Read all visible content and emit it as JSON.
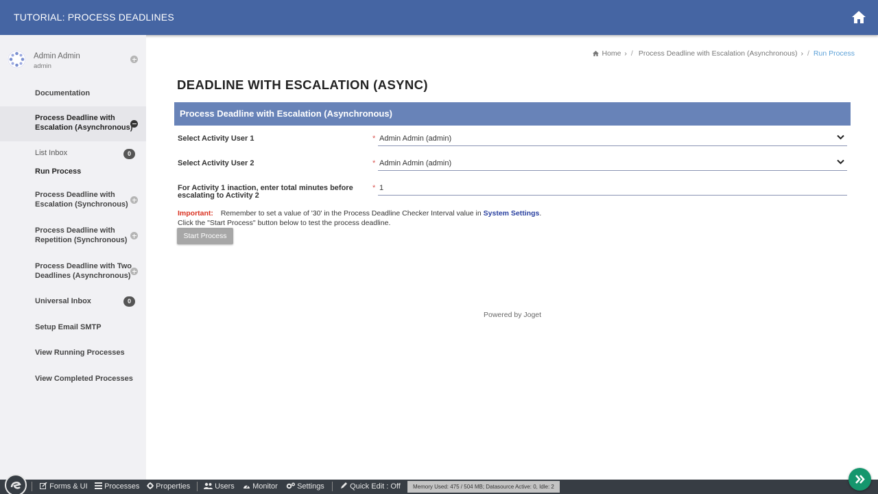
{
  "header": {
    "app_title": "TUTORIAL: PROCESS DEADLINES",
    "home_icon": "home-icon"
  },
  "sidebar": {
    "profile": {
      "name": "Admin Admin",
      "username": "admin"
    },
    "items": [
      {
        "label": "Documentation"
      },
      {
        "label_line1": "Process Deadline with",
        "label_line2": "Escalation (Asynchronous)",
        "active": true
      },
      {
        "label": "List Inbox",
        "badge": "0"
      },
      {
        "label": "Run Process"
      },
      {
        "label_line1": "Process Deadline with",
        "label_line2": "Escalation (Synchronous)"
      },
      {
        "label_line1": "Process Deadline with",
        "label_line2": "Repetition (Synchronous)"
      },
      {
        "label_line1": "Process Deadline with Two",
        "label_line2": "Deadlines (Asynchronous)"
      },
      {
        "label": "Universal Inbox",
        "badge": "0"
      },
      {
        "label": "Setup Email SMTP"
      },
      {
        "label": "View Running Processes"
      },
      {
        "label": "View Completed Processes"
      }
    ]
  },
  "breadcrumb": {
    "home": "Home",
    "parent": "Process Deadline with Escalation (Asynchronous)",
    "current": "Run Process"
  },
  "page": {
    "title": "DEADLINE WITH ESCALATION (ASYNC)",
    "form_header": "Process Deadline with Escalation (Asynchronous)",
    "fields": [
      {
        "label": "Select Activity User 1",
        "value": "Admin Admin (admin)"
      },
      {
        "label": "Select Activity User 2",
        "value": "Admin Admin (admin)"
      },
      {
        "label_line1": "For Activity 1 inaction, enter total minutes before",
        "label_line2": "escalating to Activity 2",
        "value": "1"
      }
    ],
    "required_mark": "*",
    "note": {
      "important": "Important:",
      "text": "Remember to set a value of '30' in the Process Deadline Checker Interval value in",
      "link": "System Settings",
      "end": ".",
      "line2": "Click the \"Start Process\" button below to test the process deadline."
    },
    "start_button": "Start Process",
    "powered_by": "Powered by Joget"
  },
  "bottombar": {
    "items": [
      "Forms & UI",
      "Processes",
      "Properties",
      "Users",
      "Monitor",
      "Settings",
      "Quick Edit : Off"
    ],
    "memory": "Memory Used: 475 / 504 MB; Datasource Active: 0, Idle: 2"
  }
}
